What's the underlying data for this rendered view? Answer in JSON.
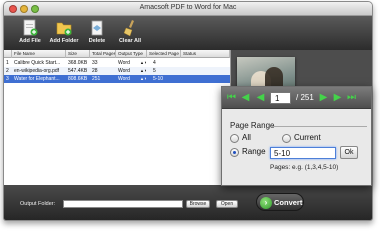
{
  "window": {
    "title": "Amacsoft PDF to Word for Mac"
  },
  "toolbar": {
    "items": [
      {
        "label": "Add File",
        "icon": "add-file-icon"
      },
      {
        "label": "Add Folder",
        "icon": "add-folder-icon"
      },
      {
        "label": "Delete",
        "icon": "delete-icon"
      },
      {
        "label": "Clear All",
        "icon": "clear-all-icon"
      }
    ]
  },
  "table": {
    "columns": [
      "",
      "File Name",
      "Size",
      "Total Pages",
      "Output Type",
      "Selected Page",
      "Status"
    ],
    "rows": [
      {
        "num": "1",
        "name": "Calibre Quick Start...",
        "size": "368.0KB",
        "pages": "33",
        "type": "Word",
        "selected": "4",
        "status": ""
      },
      {
        "num": "2",
        "name": "en-wikipedia-org.pdf",
        "size": "547.4KB",
        "pages": "28",
        "type": "Word",
        "selected": "5",
        "status": ""
      },
      {
        "num": "3",
        "name": "Water for Elephant...",
        "size": "808.6KB",
        "pages": "251",
        "type": "Word",
        "selected": "5-10",
        "status": ""
      }
    ],
    "selected_row": 2
  },
  "bottom": {
    "output_label": "Output Folder:",
    "output_value": "",
    "browse_label": "Browse",
    "open_label": "Open",
    "convert_label": "Convert"
  },
  "page_nav": {
    "current_page": "1",
    "total": "/ 251"
  },
  "page_range": {
    "title": "Page Range",
    "all_label": "All",
    "current_label": "Current",
    "range_label": "Range",
    "range_value": "5-10",
    "ok_label": "Ok",
    "hint": "Pages: e.g. (1,3,4,5-10)",
    "selected": "range"
  },
  "colors": {
    "selection": "#3f6fd2",
    "nav_arrow": "#44d34a",
    "convert_icon": "#2f9a2a"
  }
}
